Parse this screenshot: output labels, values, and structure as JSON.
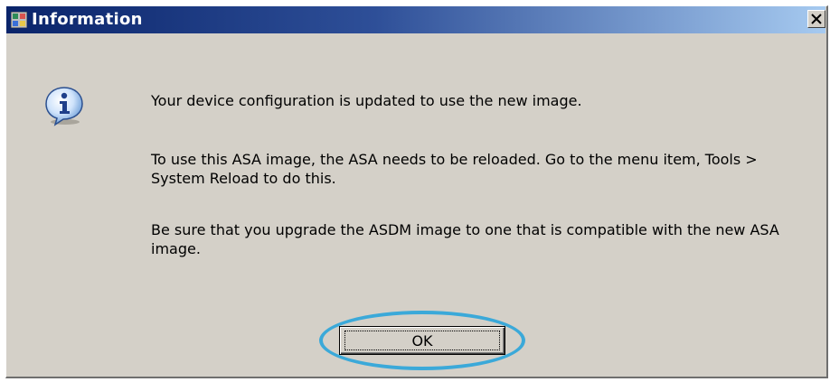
{
  "window": {
    "title": "Information",
    "app_icon": "application-icon",
    "close_icon": "close-icon"
  },
  "message": {
    "icon": "info-icon",
    "paragraph1": "Your device configuration is updated to use the new image.",
    "paragraph2": "To use this ASA image, the ASA needs to be reloaded. Go to the menu item, Tools > System Reload to do this.",
    "paragraph3": "Be sure that you upgrade the ASDM image to one that is compatible with the new ASA image."
  },
  "buttons": {
    "ok_label": "OK"
  },
  "colors": {
    "titlebar_start": "#0a246a",
    "titlebar_end": "#a6caf0",
    "dialog_background": "#d4d0c8",
    "highlight_ring": "#3ba9d9"
  }
}
